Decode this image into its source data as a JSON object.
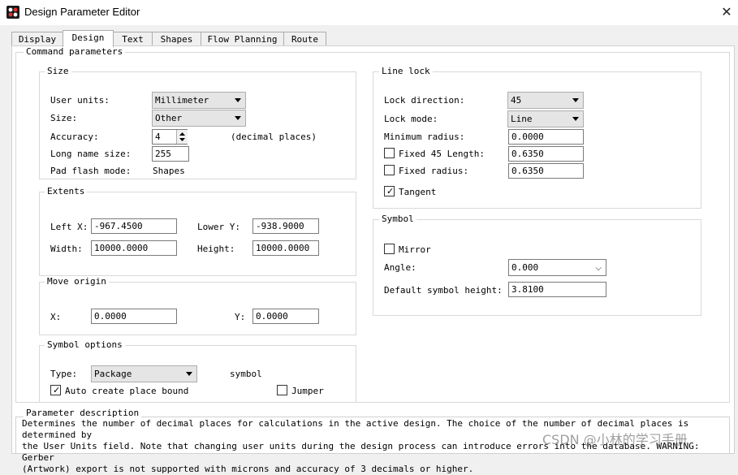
{
  "window": {
    "title": "Design Parameter Editor"
  },
  "tabs": [
    "Display",
    "Design",
    "Text",
    "Shapes",
    "Flow Planning",
    "Route"
  ],
  "command_parameters": {
    "label": "Command parameters"
  },
  "size": {
    "label": "Size",
    "user_units_label": "User units:",
    "user_units_value": "Millimeter",
    "size_label": "Size:",
    "size_value": "Other",
    "accuracy_label": "Accuracy:",
    "accuracy_value": "4",
    "accuracy_unit": "(decimal places)",
    "long_name_label": "Long name size:",
    "long_name_value": "255",
    "pad_flash_label": "Pad flash mode:",
    "pad_flash_value": "Shapes"
  },
  "extents": {
    "label": "Extents",
    "left_x_label": "Left X:",
    "left_x_value": "-967.4500",
    "lower_y_label": "Lower Y:",
    "lower_y_value": "-938.9000",
    "width_label": "Width:",
    "width_value": "10000.0000",
    "height_label": "Height:",
    "height_value": "10000.0000"
  },
  "move_origin": {
    "label": "Move origin",
    "x_label": "X:",
    "x_value": "0.0000",
    "y_label": "Y:",
    "y_value": "0.0000"
  },
  "symbol_options": {
    "label": "Symbol options",
    "type_label": "Type:",
    "type_value": "Package",
    "type_suffix": "symbol",
    "auto_create_label": "Auto create place bound",
    "auto_create_checked": true,
    "jumper_label": "Jumper",
    "jumper_checked": false
  },
  "line_lock": {
    "label": "Line lock",
    "direction_label": "Lock direction:",
    "direction_value": "45",
    "mode_label": "Lock mode:",
    "mode_value": "Line",
    "min_radius_label": "Minimum radius:",
    "min_radius_value": "0.0000",
    "fixed45_label": "Fixed 45 Length:",
    "fixed45_value": "0.6350",
    "fixed45_checked": false,
    "fixed_radius_label": "Fixed radius:",
    "fixed_radius_value": "0.6350",
    "fixed_radius_checked": false,
    "tangent_label": "Tangent",
    "tangent_checked": true
  },
  "symbol": {
    "label": "Symbol",
    "mirror_label": "Mirror",
    "mirror_checked": false,
    "angle_label": "Angle:",
    "angle_value": "0.000",
    "default_height_label": "Default symbol height:",
    "default_height_value": "3.8100"
  },
  "parameter_description": {
    "label": "Parameter description",
    "text": "Determines the number of decimal places for calculations in the active design. The choice of the number of decimal places is determined by\nthe User Units field. Note that changing user units during the design process can introduce errors into the database. WARNING: Gerber\n(Artwork) export is not supported with microns and accuracy of 3 decimals or higher."
  },
  "watermark": "CSDN @小林的学习手册",
  "icons": {
    "app": "app-logo-icon",
    "close": "close-icon",
    "dropdown": "chevron-down-icon",
    "check": "checkmark-icon"
  }
}
